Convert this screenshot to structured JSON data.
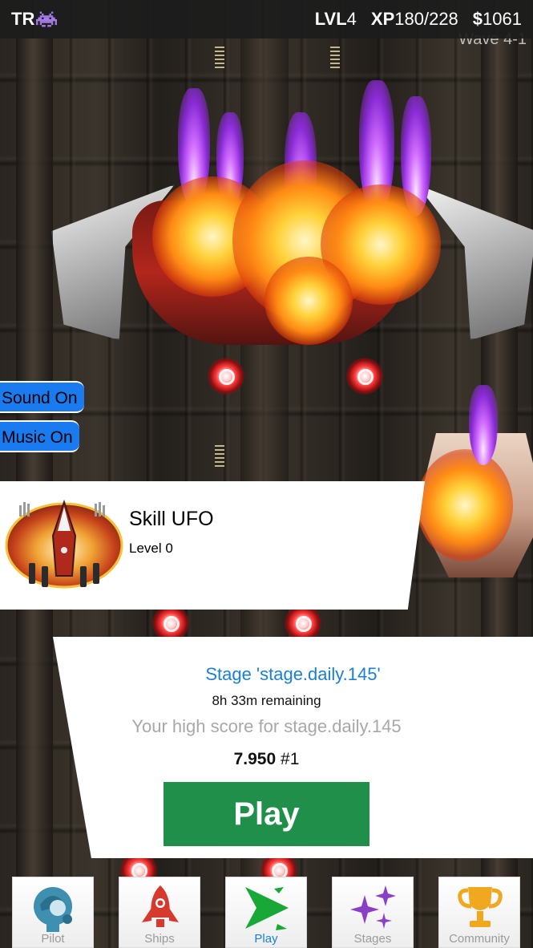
{
  "topbar": {
    "player_initials": "TR",
    "player_icon": "space-invader-icon",
    "level_prefix": "LVL",
    "level_value": "4",
    "xp_prefix": "XP",
    "xp_value": "180/228",
    "money_prefix": "$",
    "money_value": "1061"
  },
  "game": {
    "wave_label": "Wave 4-1"
  },
  "toggles": {
    "sound_label": "Sound On",
    "music_label": "Music On"
  },
  "skill": {
    "name": "Skill UFO",
    "level": "Level 0",
    "emblem_icon": "rocket-emblem-icon"
  },
  "stage": {
    "title": "Stage 'stage.daily.145'",
    "remaining": "8h 33m remaining",
    "high_score_label": "Your high score for stage.daily.145",
    "score": "7.950",
    "rank": "#1",
    "play_label": "Play"
  },
  "tabs": [
    {
      "label": "Pilot",
      "icon": "pilot-helmet-icon"
    },
    {
      "label": "Ships",
      "icon": "rocket-icon"
    },
    {
      "label": "Play",
      "icon": "play-arrow-icon"
    },
    {
      "label": "Stages",
      "icon": "stars-icon"
    },
    {
      "label": "Community",
      "icon": "trophy-icon"
    }
  ],
  "colors": {
    "accent_blue": "#1a7fd6",
    "toggle_blue": "#1a7bf0",
    "play_green": "#1f8f4a",
    "topbar_bg": "#1c1c1c"
  },
  "active_tab": "Play"
}
